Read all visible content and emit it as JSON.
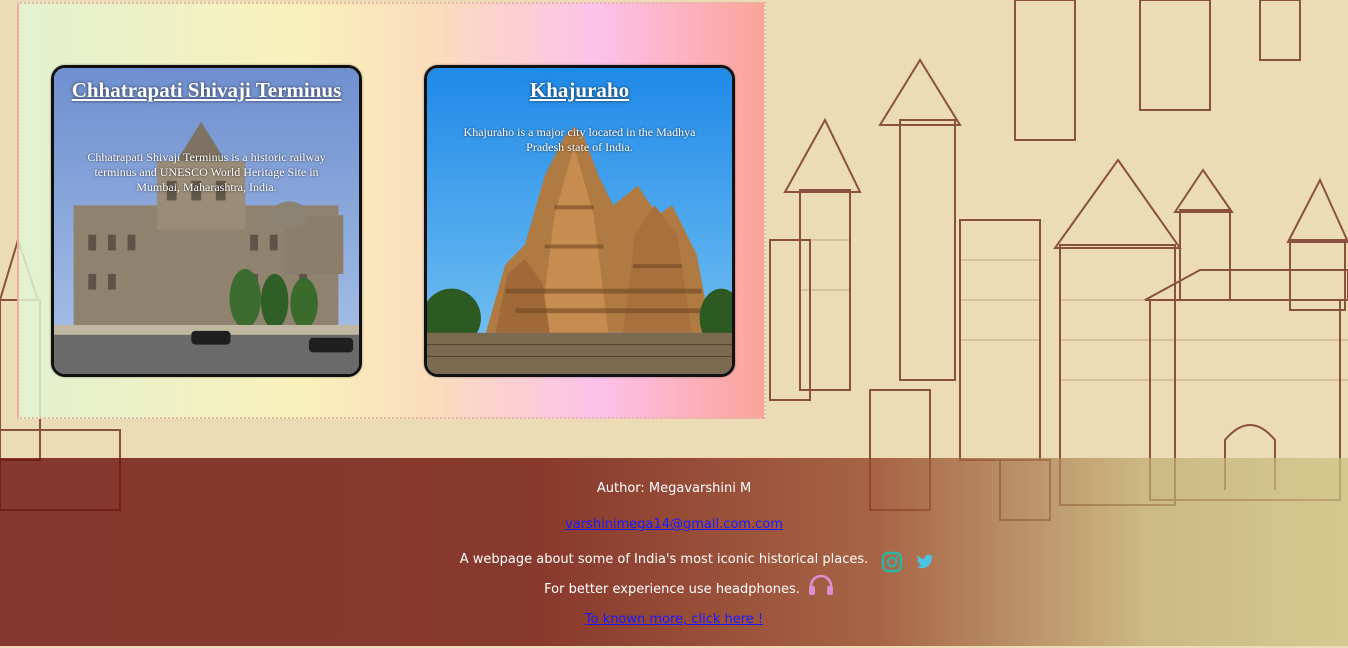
{
  "cards": [
    {
      "title": "Chhatrapati Shivaji Terminus",
      "description": "Chhatrapati Shivaji Terminus is a historic railway terminus and UNESCO World Heritage Site in Mumbai, Maharashtra, India."
    },
    {
      "title": "Khajuraho",
      "description": "Khajuraho is a major city located in the Madhya Pradesh state of India."
    }
  ],
  "footer": {
    "author": "Author: Megavarshini M",
    "email": "varshinimega14@gmail.com.com",
    "about": "A webpage about some of India's most iconic historical places.",
    "headphones_note": "For better experience use headphones.",
    "more_link": "To known more, click here !"
  },
  "icons": {
    "instagram": "instagram-icon",
    "twitter": "twitter-icon",
    "headphones": "headphones-icon"
  },
  "colors": {
    "footer": "#6e1412",
    "link": "#1a1aff",
    "instagram": "#2bb3a3",
    "twitter": "#4ec3e6",
    "headphones": "#d98fd0"
  }
}
